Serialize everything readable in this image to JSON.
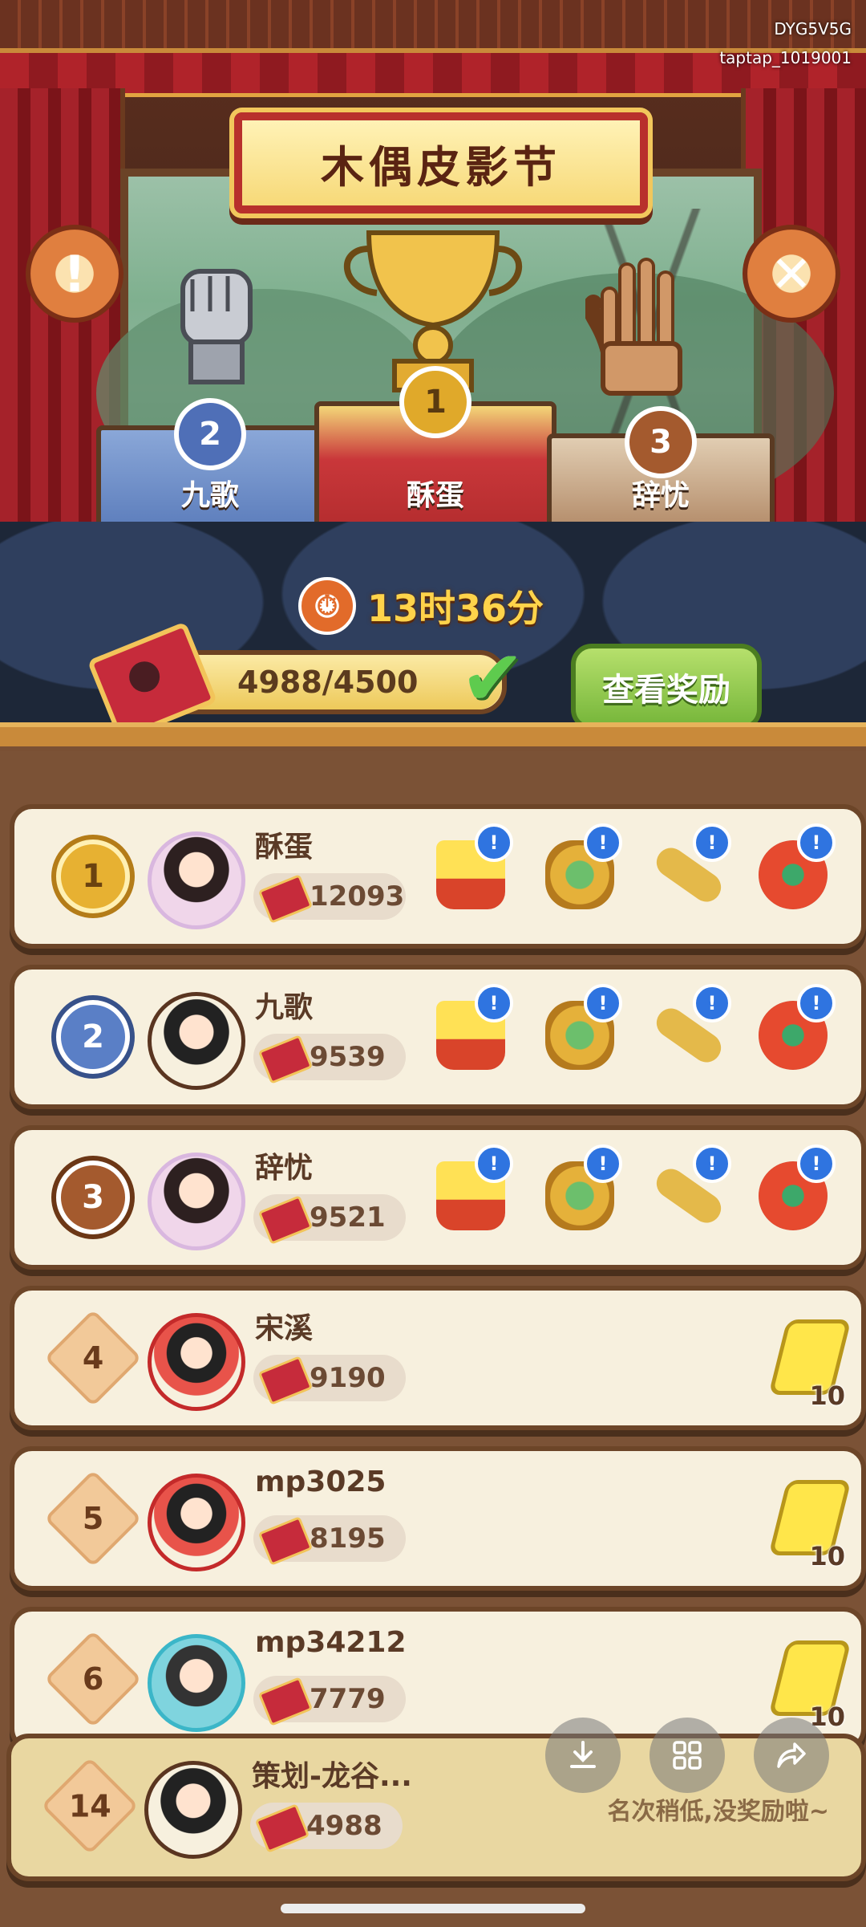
{
  "watermark": {
    "line1": "DYG5V5G",
    "line2": "taptap_1019001"
  },
  "header": {
    "title": "木偶皮影节",
    "info_icon": "exclamation-icon",
    "close_icon": "close-icon"
  },
  "podium": {
    "first": {
      "rank": "1",
      "name": "酥蛋"
    },
    "second": {
      "rank": "2",
      "name": "九歌"
    },
    "third": {
      "rank": "3",
      "name": "辞忧"
    }
  },
  "timer": {
    "text": "13时36分",
    "icon": "clock-icon"
  },
  "progress": {
    "text": "4988/4500",
    "current": 4988,
    "target": 4500,
    "icon": "ticket-icon",
    "complete_icon": "checkmark-icon"
  },
  "reward_button": {
    "label": "查看奖励"
  },
  "leaderboard": [
    {
      "rank": "1",
      "name": "酥蛋",
      "score": "12093",
      "rewards": [
        "fries-bucket-icon",
        "treasure-chest-icon",
        "key-icon",
        "lucky-bag-icon"
      ]
    },
    {
      "rank": "2",
      "name": "九歌",
      "score": "9539",
      "rewards": [
        "fries-bucket-icon",
        "treasure-chest-icon",
        "key-icon",
        "lucky-bag-icon"
      ]
    },
    {
      "rank": "3",
      "name": "辞忧",
      "score": "9521",
      "rewards": [
        "fries-bucket-icon",
        "treasure-chest-icon",
        "key-icon",
        "lucky-bag-icon"
      ]
    },
    {
      "rank": "4",
      "name": "宋溪",
      "score": "9190",
      "energy": "10"
    },
    {
      "rank": "5",
      "name": "mp3025",
      "score": "8195",
      "energy": "10"
    },
    {
      "rank": "6",
      "name": "mp34212",
      "score": "7779",
      "energy": "10"
    }
  ],
  "my_entry": {
    "rank": "14",
    "name": "策划-龙谷...",
    "score": "4988",
    "hint": "名次稍低,没奖励啦~"
  },
  "overlay": {
    "download_icon": "download-icon",
    "grid_icon": "grid-icon",
    "share_icon": "share-icon"
  },
  "colors": {
    "accent_red": "#b8302c",
    "gold": "#e7b132",
    "reward_green": "#76b63a",
    "alert_blue": "#2f74e0"
  }
}
